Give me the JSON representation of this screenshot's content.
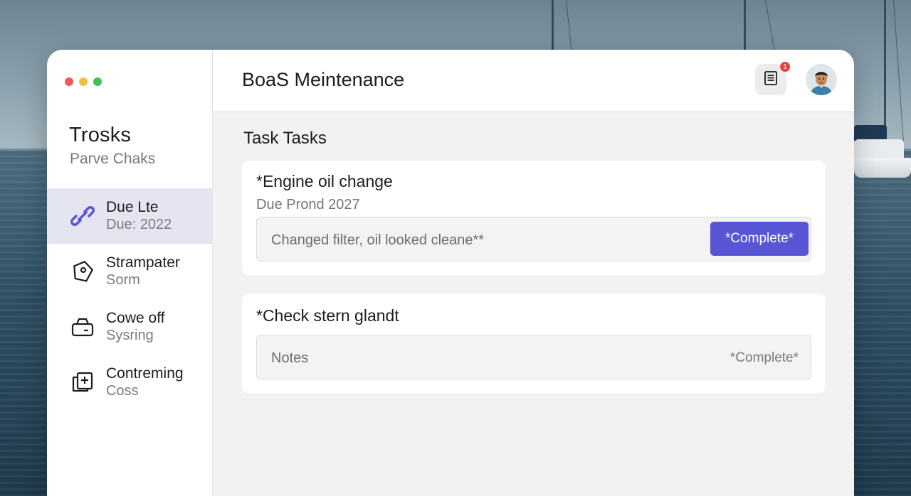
{
  "window": {
    "controls": [
      "close",
      "minimize",
      "zoom"
    ]
  },
  "sidebar": {
    "title": "Trosks",
    "subtitle": "Parve Chaks",
    "items": [
      {
        "label": "Due Lte",
        "sub": "Due: 2022",
        "icon": "link-icon",
        "active": true
      },
      {
        "label": "Strampater",
        "sub": "Sorm",
        "icon": "tag-icon",
        "active": false
      },
      {
        "label": "Cowe off",
        "sub": "Sysring",
        "icon": "lock-box-icon",
        "active": false
      },
      {
        "label": "Contreming",
        "sub": "Coss",
        "icon": "document-plus-icon",
        "active": false
      }
    ]
  },
  "header": {
    "title": "BoaS Meintenance",
    "notification_count": "1",
    "notes_icon": "notes-icon",
    "avatar_icon": "user-avatar"
  },
  "main": {
    "section_title": "Task Tasks",
    "tasks": [
      {
        "title": "*Engine oil change",
        "due": "Due Prond 2027",
        "notes": "Changed filter, oil looked cleane**",
        "complete_label": "*Complete*"
      },
      {
        "title": "*Check stern glandt",
        "notes_placeholder": "Notes",
        "complete_label": "*Complete*"
      }
    ]
  },
  "colors": {
    "accent": "#5956d6",
    "active_nav": "#e5e5f1",
    "badge": "#e5433d"
  }
}
